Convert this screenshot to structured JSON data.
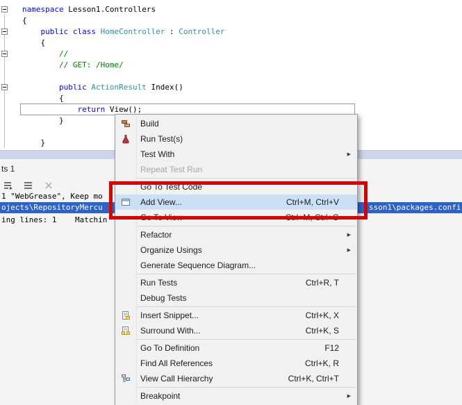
{
  "editor": {
    "colors": {
      "keyword": "#0000ff",
      "type": "#2b91af",
      "comment": "#008000",
      "plain": "#000000"
    },
    "fold_box_lines": [
      1,
      3,
      5,
      8
    ],
    "lines": [
      [
        {
          "t": "namespace",
          "c": "kw"
        },
        {
          "t": " Lesson1.Controllers",
          "c": "pl"
        }
      ],
      [
        {
          "t": "{",
          "c": "pl"
        }
      ],
      [
        {
          "t": "    ",
          "c": "pl"
        },
        {
          "t": "public",
          "c": "kw"
        },
        {
          "t": " ",
          "c": "pl"
        },
        {
          "t": "class",
          "c": "kw"
        },
        {
          "t": " ",
          "c": "pl"
        },
        {
          "t": "HomeController",
          "c": "ty"
        },
        {
          "t": " : ",
          "c": "pl"
        },
        {
          "t": "Controller",
          "c": "ty"
        }
      ],
      [
        {
          "t": "    {",
          "c": "pl"
        }
      ],
      [
        {
          "t": "        //",
          "c": "cm"
        }
      ],
      [
        {
          "t": "        // GET: /Home/",
          "c": "cm"
        }
      ],
      [],
      [
        {
          "t": "        ",
          "c": "pl"
        },
        {
          "t": "public",
          "c": "kw"
        },
        {
          "t": " ",
          "c": "pl"
        },
        {
          "t": "ActionResult",
          "c": "ty"
        },
        {
          "t": " Index()",
          "c": "pl"
        }
      ],
      [
        {
          "t": "        {",
          "c": "pl"
        }
      ],
      [
        {
          "t": "            ",
          "c": "pl"
        },
        {
          "t": "return",
          "c": "kw"
        },
        {
          "t": " View();",
          "c": "pl"
        }
      ],
      [
        {
          "t": "        }",
          "c": "pl"
        }
      ],
      [],
      [
        {
          "t": "    }",
          "c": "pl"
        }
      ]
    ]
  },
  "panel": {
    "title_fragment": "ts 1",
    "toolbar": [
      {
        "id": "go-to-location",
        "icon": "go-to-location-icon"
      },
      {
        "id": "list-results",
        "icon": "list-results-icon"
      },
      {
        "id": "clear-results",
        "icon": "clear-results-icon"
      }
    ],
    "result_line_1": "1 \"WebGrease\", Keep mo",
    "selected_result_left": "ojects\\RepositoryMercu",
    "selected_result_right": "sson1\\packages.confi",
    "result_line_3": "ing lines: 1    Matchin",
    "selection_color": "#2d62c9"
  },
  "context_menu": {
    "highlight_color": "#cbe0f5",
    "items": [
      {
        "id": "build",
        "label": "Build",
        "icon": "build-icon"
      },
      {
        "id": "run-test-s",
        "label": "Run Test(s)",
        "icon": "run-test-icon"
      },
      {
        "id": "test-with",
        "label": "Test With",
        "submenu": true
      },
      {
        "id": "repeat-test-run",
        "label": "Repeat Test Run",
        "disabled": true,
        "separator_after": true
      },
      {
        "id": "go-to-test-code",
        "label": "Go To Test Code"
      },
      {
        "id": "add-view",
        "label": "Add View...",
        "shortcut": "Ctrl+M, Ctrl+V",
        "icon": "add-view-icon",
        "highlighted": true
      },
      {
        "id": "go-to-view",
        "label": "Go To View",
        "shortcut": "Ctrl+M, Ctrl+G",
        "separator_after": true
      },
      {
        "id": "refactor",
        "label": "Refactor",
        "submenu": true
      },
      {
        "id": "organize-usings",
        "label": "Organize Usings",
        "submenu": true
      },
      {
        "id": "generate-sequence-diagram",
        "label": "Generate Sequence Diagram...",
        "separator_after": true
      },
      {
        "id": "run-tests",
        "label": "Run Tests",
        "shortcut": "Ctrl+R, T"
      },
      {
        "id": "debug-tests",
        "label": "Debug Tests",
        "separator_after": true
      },
      {
        "id": "insert-snippet",
        "label": "Insert Snippet...",
        "shortcut": "Ctrl+K, X",
        "icon": "insert-snippet-icon"
      },
      {
        "id": "surround-with",
        "label": "Surround With...",
        "shortcut": "Ctrl+K, S",
        "icon": "surround-with-icon",
        "separator_after": true
      },
      {
        "id": "go-to-definition",
        "label": "Go To Definition",
        "shortcut": "F12"
      },
      {
        "id": "find-all-references",
        "label": "Find All References",
        "shortcut": "Ctrl+K, R"
      },
      {
        "id": "view-call-hierarchy",
        "label": "View Call Hierarchy",
        "shortcut": "Ctrl+K, Ctrl+T",
        "icon": "view-call-hierarchy-icon",
        "separator_after": true
      },
      {
        "id": "breakpoint",
        "label": "Breakpoint",
        "submenu": true
      }
    ]
  },
  "annotation": {
    "type": "red-highlight-box",
    "color": "#d40404"
  }
}
